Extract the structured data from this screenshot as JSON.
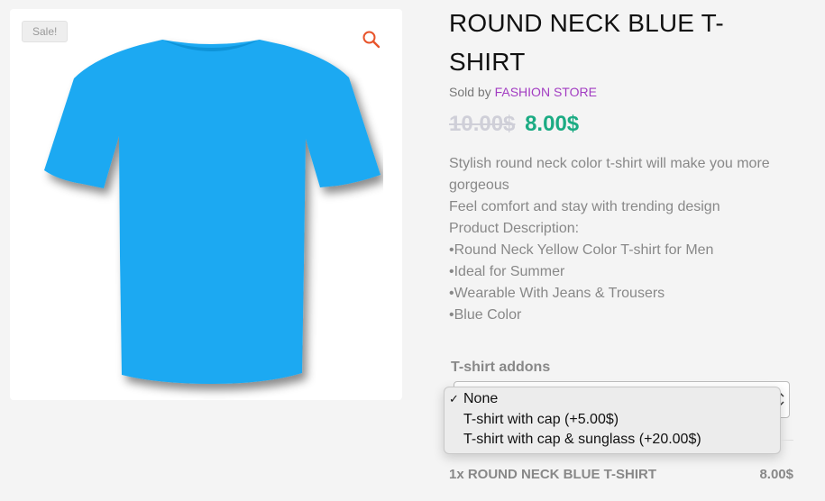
{
  "product": {
    "sale_badge": "Sale!",
    "title": "ROUND NECK BLUE T-SHIRT",
    "sold_by_prefix": "Sold by",
    "vendor": "FASHION STORE",
    "old_price": "10.00$",
    "new_price": "8.00$",
    "description": [
      "Stylish round neck color t-shirt will make you more gorgeous",
      "Feel comfort and stay with trending design",
      "Product Description:",
      "•Round Neck Yellow Color T-shirt for Men",
      "•Ideal for Summer",
      "•Wearable With Jeans & Trousers",
      "•Blue Color"
    ],
    "image_color": "#1aa9f2"
  },
  "addons": {
    "label": "T-shirt addons",
    "options": [
      {
        "label": "None",
        "selected": true
      },
      {
        "label": "T-shirt with cap (+5.00$)",
        "selected": false
      },
      {
        "label": "T-shirt with cap & sunglass (+20.00$)",
        "selected": false
      }
    ]
  },
  "summary": {
    "label": "1x ROUND NECK BLUE T-SHIRT",
    "price": "8.00$"
  },
  "icons": {
    "zoom": "magnifier-icon",
    "check": "checkmark-icon",
    "select": "chevron-down-icon"
  }
}
